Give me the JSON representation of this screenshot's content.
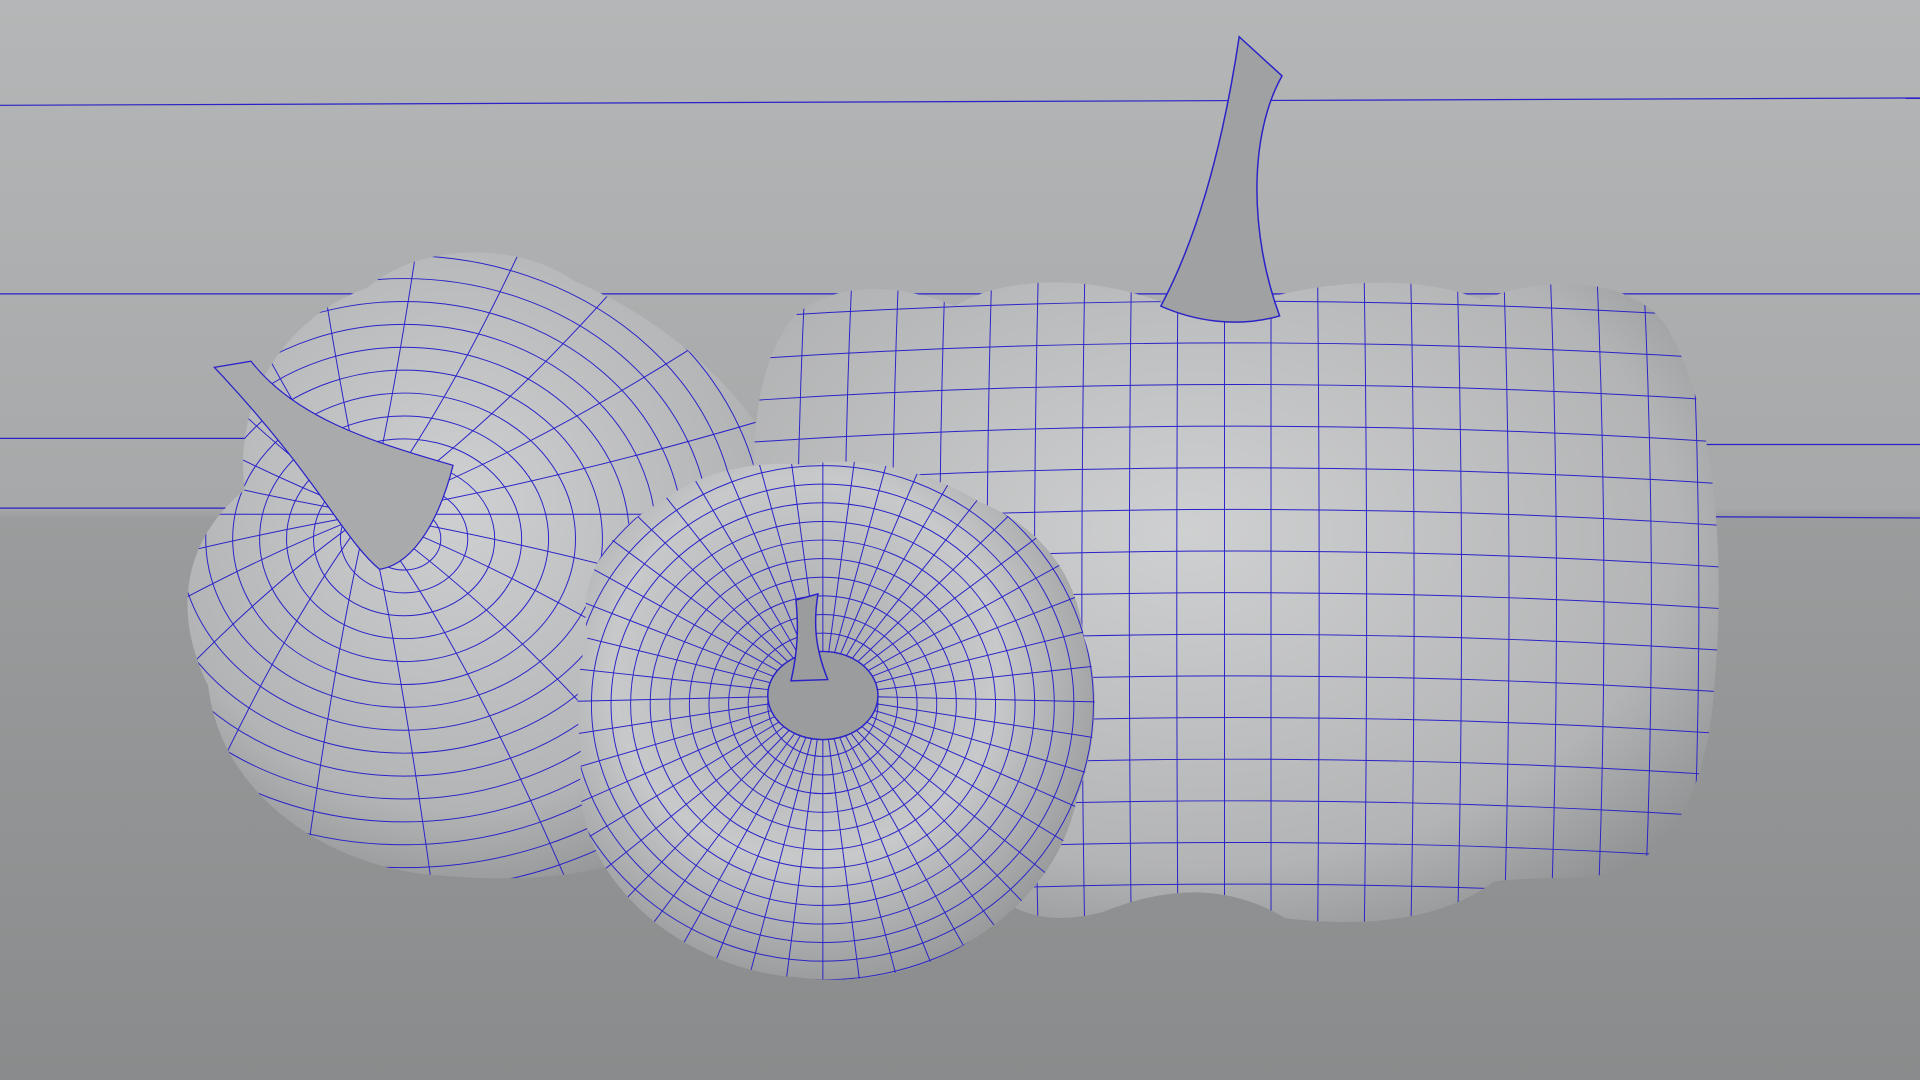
{
  "viewport": {
    "colors": {
      "background_top": "#b4b6b7",
      "background_bottom": "#8a8c8d",
      "surface_light": "#c9cacb",
      "surface_dark": "#7d7f80",
      "wire": "#2a22c8"
    },
    "objects": [
      "bell-pepper",
      "pumpkin",
      "pattypan-squash"
    ]
  }
}
